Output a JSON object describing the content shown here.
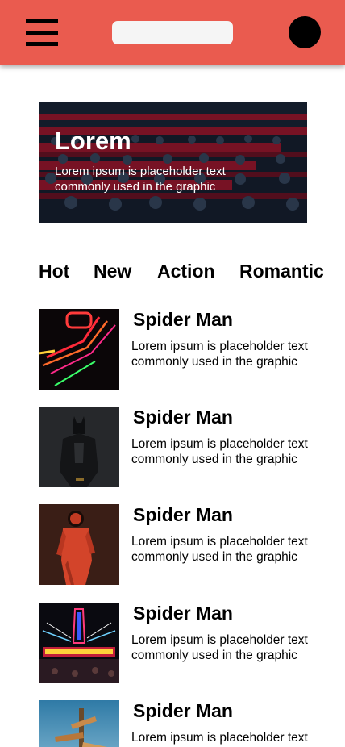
{
  "header": {
    "menu_icon": "hamburger-menu-icon",
    "search_placeholder": "",
    "avatar_icon": "avatar"
  },
  "hero": {
    "title": "Lorem",
    "text": "Lorem ipsum is placeholder text commonly used in the graphic"
  },
  "categories": [
    "Hot",
    "New",
    "Action",
    "Romantic"
  ],
  "movies": [
    {
      "title": "Spider Man",
      "description": "Lorem ipsum is placeholder text commonly used in the graphic"
    },
    {
      "title": "Spider Man",
      "description": "Lorem ipsum is placeholder text commonly used in the graphic"
    },
    {
      "title": "Spider Man",
      "description": "Lorem ipsum is placeholder text commonly used in the graphic"
    },
    {
      "title": "Spider Man",
      "description": "Lorem ipsum is placeholder text commonly used in the graphic"
    },
    {
      "title": "Spider Man",
      "description": "Lorem ipsum is placeholder text commonly used in the graphic"
    }
  ],
  "colors": {
    "header_bg": "#ea5b4f",
    "search_bg": "#f5f5f5",
    "text": "#000000"
  }
}
